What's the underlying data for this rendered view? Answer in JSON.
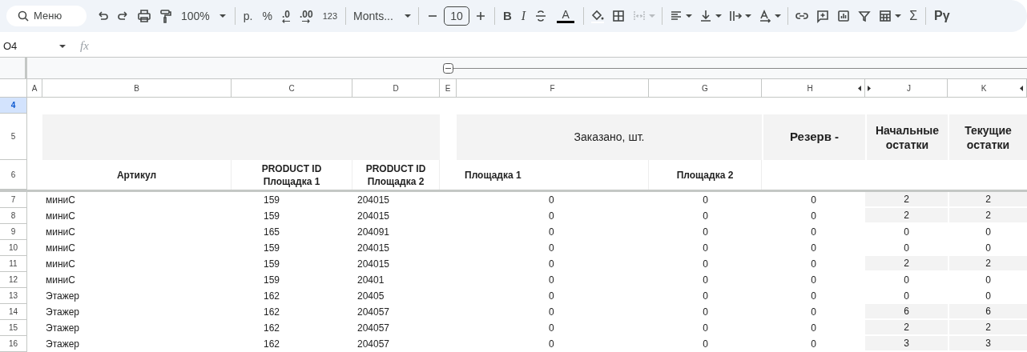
{
  "toolbar": {
    "search": {
      "label": "Меню"
    },
    "zoom": "100%",
    "currency": "р.",
    "percent": "%",
    "decrease_decimals": ".0",
    "increase_decimals": ".00",
    "number_format": "123",
    "font": "Monts...",
    "font_size": "10",
    "bold": "B",
    "italic": "I",
    "text_color": "A",
    "merge_cells": {
      "disabled": true
    },
    "functions": "Σ",
    "last_button": "Pγ"
  },
  "formula_bar": {
    "name_box": "O4",
    "fx": "fx"
  },
  "columns": [
    {
      "label": "A",
      "hidden_before": false,
      "hidden_after": false
    },
    {
      "label": "B",
      "hidden_before": false,
      "hidden_after": false
    },
    {
      "label": "C",
      "hidden_before": false,
      "hidden_after": false
    },
    {
      "label": "D",
      "hidden_before": false,
      "hidden_after": false
    },
    {
      "label": "E",
      "hidden_before": false,
      "hidden_after": false
    },
    {
      "label": "F",
      "hidden_before": false,
      "hidden_after": false
    },
    {
      "label": "G",
      "hidden_before": false,
      "hidden_after": false
    },
    {
      "label": "H",
      "hidden_before": false,
      "hidden_after": true
    },
    {
      "label": "J",
      "hidden_before": true,
      "hidden_after": false
    },
    {
      "label": "K",
      "hidden_before": false,
      "hidden_after": true
    }
  ],
  "header_rows": [
    {
      "number": "4",
      "selected": true
    },
    {
      "number": "5",
      "selected": false
    },
    {
      "number": "6",
      "selected": false
    }
  ],
  "header": {
    "ordered": "Заказано, шт.",
    "reserve": "Резерв -",
    "initial_stock": "Начальные\nостатки",
    "current_stock": "Текущие\nостатки",
    "article": "Артикул",
    "product_id_1": "PRODUCT ID\nПлощадка 1",
    "product_id_2": "PRODUCT ID\nПлощадка 2",
    "site_1": "Площадка 1",
    "site_2": "Площадка 2"
  },
  "rows": [
    {
      "number": "7",
      "article": "миниС",
      "id_1": "159",
      "id_2": "204015",
      "ordered_1": "0",
      "ordered_2": "0",
      "reserve": "0",
      "initial": "2",
      "current": "2",
      "shaded": true
    },
    {
      "number": "8",
      "article": "миниС",
      "id_1": "159",
      "id_2": "204015",
      "ordered_1": "0",
      "ordered_2": "0",
      "reserve": "0",
      "initial": "2",
      "current": "2",
      "shaded": true
    },
    {
      "number": "9",
      "article": "миниС",
      "id_1": "165",
      "id_2": "204091",
      "ordered_1": "0",
      "ordered_2": "0",
      "reserve": "0",
      "initial": "0",
      "current": "0",
      "shaded": false
    },
    {
      "number": "10",
      "article": "миниС",
      "id_1": "159",
      "id_2": "204015",
      "ordered_1": "0",
      "ordered_2": "0",
      "reserve": "0",
      "initial": "0",
      "current": "0",
      "shaded": false
    },
    {
      "number": "11",
      "article": "миниС",
      "id_1": "159",
      "id_2": "204015",
      "ordered_1": "0",
      "ordered_2": "0",
      "reserve": "0",
      "initial": "2",
      "current": "2",
      "shaded": true
    },
    {
      "number": "12",
      "article": "миниС",
      "id_1": "159",
      "id_2": "20401",
      "ordered_1": "0",
      "ordered_2": "0",
      "reserve": "0",
      "initial": "0",
      "current": "0",
      "shaded": false
    },
    {
      "number": "13",
      "article": "Этажер",
      "id_1": "162",
      "id_2": "20405",
      "ordered_1": "0",
      "ordered_2": "0",
      "reserve": "0",
      "initial": "0",
      "current": "0",
      "shaded": false
    },
    {
      "number": "14",
      "article": "Этажер",
      "id_1": "162",
      "id_2": "204057",
      "ordered_1": "0",
      "ordered_2": "0",
      "reserve": "0",
      "initial": "6",
      "current": "6",
      "shaded": true
    },
    {
      "number": "15",
      "article": "Этажер",
      "id_1": "162",
      "id_2": "204057",
      "ordered_1": "0",
      "ordered_2": "0",
      "reserve": "0",
      "initial": "2",
      "current": "2",
      "shaded": true
    },
    {
      "number": "16",
      "article": "Этажер",
      "id_1": "162",
      "id_2": "204057",
      "ordered_1": "0",
      "ordered_2": "0",
      "reserve": "0",
      "initial": "3",
      "current": "3",
      "shaded": true
    }
  ]
}
